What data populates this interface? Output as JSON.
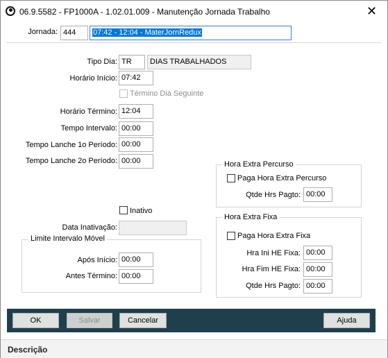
{
  "window": {
    "title": "06.9.5582 - FP1000A - 1.02.01.009 - Manutenção Jornada Trabalho",
    "close_glyph": "✕",
    "app_icon": "totvs-logo-icon"
  },
  "header": {
    "jornada_label": "Jornada:",
    "jornada_code": "444",
    "jornada_desc": "07:42 - 12:04 - MaterJornRedux"
  },
  "form": {
    "tipo_dia_label": "Tipo Dia:",
    "tipo_dia_code": "TR",
    "tipo_dia_desc": "DIAS TRABALHADOS",
    "horario_inicio_label": "Horário Início:",
    "horario_inicio_value": "07:42",
    "termino_dia_seguinte_label": "Término Dia Seguinte",
    "horario_termino_label": "Horário Término:",
    "horario_termino_value": "12:04",
    "tempo_intervalo_label": "Tempo Intervalo:",
    "tempo_intervalo_value": "00:00",
    "tempo_lanche_1_label": "Tempo Lanche 1o Período:",
    "tempo_lanche_1_value": "00:00",
    "tempo_lanche_2_label": "Tempo Lanche 2o Período:",
    "tempo_lanche_2_value": "00:00",
    "inativo_label": "Inativo",
    "data_inativacao_label": "Data Inativação:",
    "data_inativacao_value": ""
  },
  "limite_intervalo": {
    "title": "Limite Intervalo Móvel",
    "apos_inicio_label": "Após Início:",
    "apos_inicio_value": "00:00",
    "antes_termino_label": "Antes Término:",
    "antes_termino_value": "00:00"
  },
  "hora_extra_percurso": {
    "title": "Hora Extra Percurso",
    "paga_label": "Paga Hora Extra Percurso",
    "qtde_label": "Qtde Hrs Pagto:",
    "qtde_value": "00:00"
  },
  "hora_extra_fixa": {
    "title": "Hora Extra Fixa",
    "paga_label": "Paga Hora Extra Fixa",
    "hra_ini_label": "Hra Ini HE Fixa:",
    "hra_ini_value": "00:00",
    "hra_fim_label": "Hra Fim HE Fixa:",
    "hra_fim_value": "00:00",
    "qtde_label": "Qtde Hrs Pagto:",
    "qtde_value": "00:00"
  },
  "buttons": {
    "ok": "OK",
    "salvar": "Salvar",
    "cancelar": "Cancelar",
    "ajuda": "Ajuda"
  },
  "status": {
    "descricao": "Descrição"
  }
}
